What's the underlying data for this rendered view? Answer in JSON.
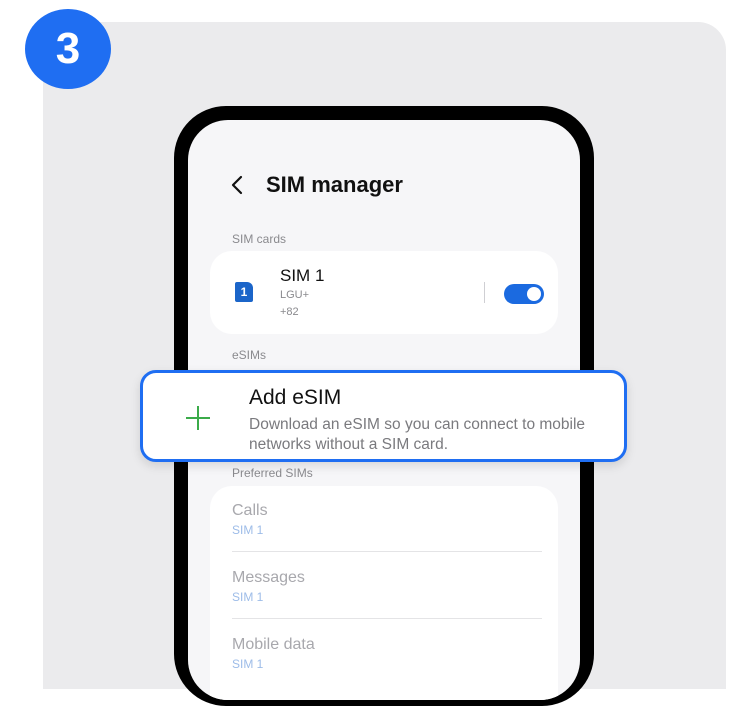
{
  "step": {
    "number": "3"
  },
  "header": {
    "title": "SIM manager"
  },
  "sections": {
    "sim_cards_label": "SIM cards",
    "esims_label": "eSIMs",
    "preferred_label": "Preferred SIMs"
  },
  "sim": {
    "icon_number": "1",
    "name": "SIM 1",
    "carrier": "LGU+",
    "number": "+82",
    "enabled": true
  },
  "add_esim": {
    "title": "Add eSIM",
    "description": "Download an eSIM so you can connect to mobile networks without a SIM card."
  },
  "preferred": [
    {
      "title": "Calls",
      "value": "SIM 1"
    },
    {
      "title": "Messages",
      "value": "SIM 1"
    },
    {
      "title": "Mobile data",
      "value": "SIM 1"
    }
  ],
  "colors": {
    "accent": "#1f6ef2",
    "toggle": "#1b6ae0",
    "plus": "#3bab4a"
  }
}
